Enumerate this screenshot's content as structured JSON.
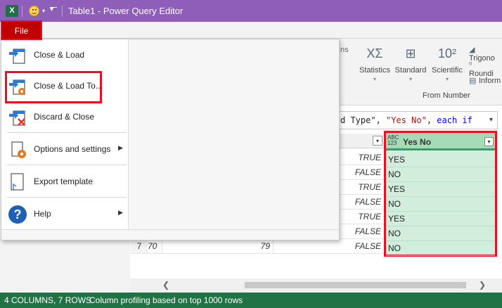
{
  "window": {
    "title": "Table1 - Power Query Editor",
    "excel_glyph": "X"
  },
  "file_tab": {
    "label": "File"
  },
  "file_menu": {
    "items": [
      {
        "label": "Close & Load",
        "icon": "close-load-icon"
      },
      {
        "label": "Close & Load To...",
        "icon": "close-load-to-icon"
      },
      {
        "label": "Discard & Close",
        "icon": "discard-close-icon"
      },
      {
        "label": "Options and settings",
        "icon": "options-settings-icon"
      },
      {
        "label": "Export template",
        "icon": "export-template-icon"
      },
      {
        "label": "Help",
        "icon": "help-icon"
      }
    ]
  },
  "ribbon": {
    "fragment_text": "ns",
    "buttons": [
      {
        "label": "Statistics",
        "icon": "statistics-icon",
        "glyph": "XΣ"
      },
      {
        "label": "Standard",
        "icon": "standard-icon",
        "glyph": "⊞"
      },
      {
        "label": "Scientific",
        "icon": "scientific-icon",
        "glyph": "10²"
      }
    ],
    "small_buttons": [
      {
        "label": "Trigono",
        "icon": "trigonometry-icon"
      },
      {
        "label": "Roundi",
        "icon": "rounding-icon"
      },
      {
        "label": "Inform",
        "icon": "information-icon"
      }
    ],
    "group_label": "From Number"
  },
  "formula_bar": {
    "prefix": "d Type\", ",
    "string_value": "\"Yes No\"",
    "separator": ", ",
    "keyword": "each if"
  },
  "grid": {
    "rows": [
      {
        "col_b": "TRUE",
        "yes_no": "YES"
      },
      {
        "col_b": "FALSE",
        "yes_no": "NO"
      },
      {
        "col_b": "TRUE",
        "yes_no": "YES"
      },
      {
        "col_b": "FALSE",
        "yes_no": "NO"
      },
      {
        "col_b": "TRUE",
        "yes_no": "YES"
      },
      {
        "col_b": "FALSE",
        "yes_no": "NO"
      },
      {
        "row_num": "7",
        "col_a": "70",
        "col_mid": "79",
        "col_b": "FALSE",
        "yes_no": "NO"
      }
    ],
    "yes_no_header": {
      "type_top": "ABC",
      "type_bottom": "123",
      "title": "Yes No"
    }
  },
  "status_bar": {
    "summary": "4 COLUMNS, 7 ROWS",
    "profiling": "Column profiling based on top 1000 rows"
  },
  "colors": {
    "title_bar": "#8E5EB8",
    "file_tab": "#C00000",
    "status_bar": "#217346",
    "highlight_box": "#e81123",
    "yes_no_column": "#d3eddd"
  }
}
